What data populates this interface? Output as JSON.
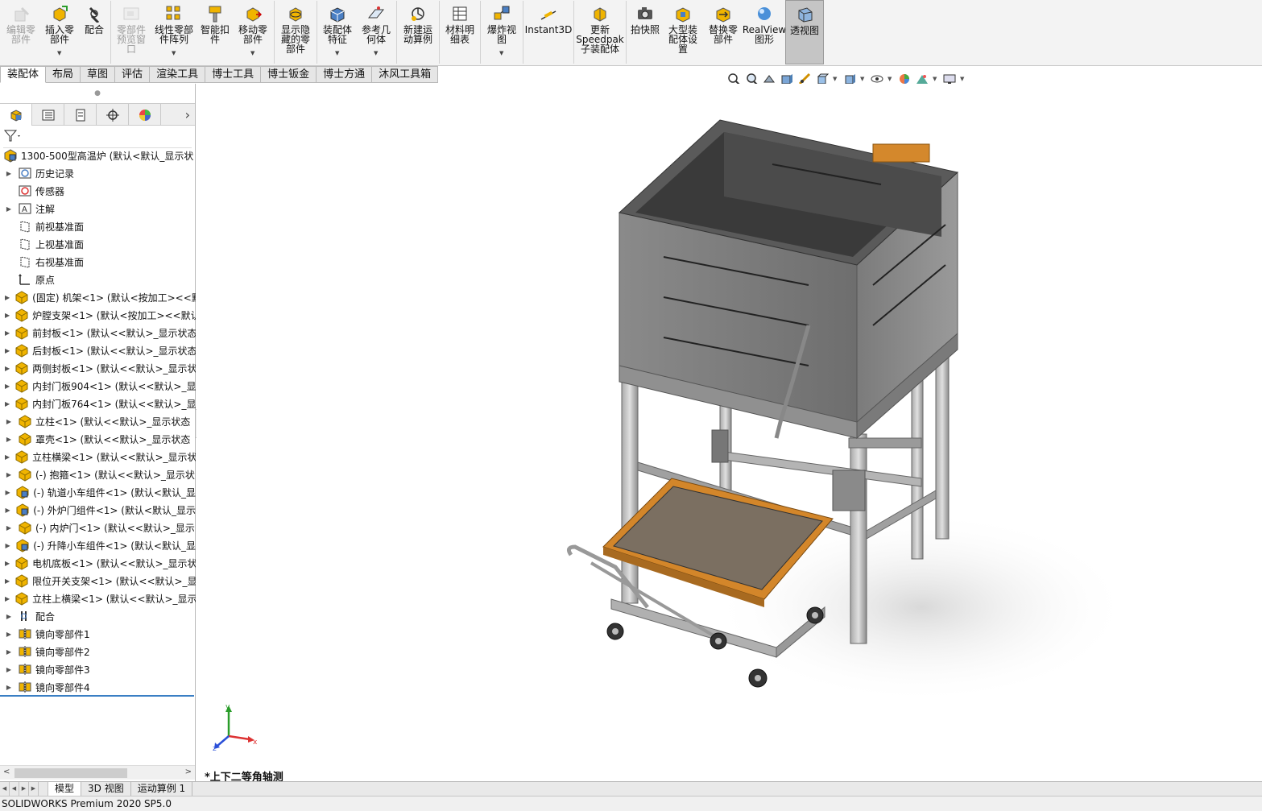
{
  "ribbon": {
    "buttons": [
      {
        "label": "编辑零\n部件",
        "icon": "edit-component-icon",
        "disabled": true
      },
      {
        "label": "插入零\n部件",
        "icon": "insert-component-icon",
        "caret": true
      },
      {
        "label": "配合",
        "icon": "mate-icon"
      },
      {
        "label": "零部件\n预览窗\n口",
        "icon": "component-preview-icon",
        "disabled": true
      },
      {
        "label": "线性零部\n件阵列",
        "icon": "linear-pattern-icon",
        "caret": true
      },
      {
        "label": "智能扣\n件",
        "icon": "smart-fasteners-icon"
      },
      {
        "label": "移动零\n部件",
        "icon": "move-component-icon",
        "caret": true
      },
      {
        "label": "显示隐\n藏的零\n部件",
        "icon": "show-hidden-icon"
      },
      {
        "label": "装配体\n特征",
        "icon": "assembly-features-icon",
        "caret": true
      },
      {
        "label": "参考几\n何体",
        "icon": "reference-geometry-icon",
        "caret": true
      },
      {
        "label": "新建运\n动算例",
        "icon": "motion-study-icon"
      },
      {
        "label": "材料明\n细表",
        "icon": "bom-icon"
      },
      {
        "label": "爆炸视\n图",
        "icon": "exploded-view-icon",
        "caret": true
      },
      {
        "label": "Instant3D",
        "icon": "instant3d-icon"
      },
      {
        "label": "更新\nSpeedpak\n子装配体",
        "icon": "speedpak-icon"
      },
      {
        "label": "拍快照",
        "icon": "snapshot-icon"
      },
      {
        "label": "大型装\n配体设\n置",
        "icon": "large-assembly-icon"
      },
      {
        "label": "替换零\n部件",
        "icon": "replace-component-icon"
      },
      {
        "label": "RealView\n图形",
        "icon": "realview-icon"
      },
      {
        "label": "透视图",
        "icon": "perspective-icon",
        "active": true
      }
    ]
  },
  "tabs": [
    "装配体",
    "布局",
    "草图",
    "评估",
    "渲染工具",
    "博士工具",
    "博士钣金",
    "博士方通",
    "沐风工具箱"
  ],
  "tree": {
    "root": "1300-500型高温炉 (默认<默认_显示状",
    "items": [
      {
        "label": "历史记录",
        "icon": "history-icon",
        "expand": true
      },
      {
        "label": "传感器",
        "icon": "sensor-icon",
        "expand": false
      },
      {
        "label": "注解",
        "icon": "annotation-icon",
        "expand": true
      },
      {
        "label": "前视基准面",
        "icon": "plane-icon",
        "expand": false
      },
      {
        "label": "上视基准面",
        "icon": "plane-icon",
        "expand": false
      },
      {
        "label": "右视基准面",
        "icon": "plane-icon",
        "expand": false
      },
      {
        "label": "原点",
        "icon": "origin-icon",
        "expand": false
      },
      {
        "label": "(固定) 机架<1> (默认<按加工><<默",
        "icon": "part-icon",
        "expand": true
      },
      {
        "label": "炉膛支架<1> (默认<按加工><<默认",
        "icon": "part-icon",
        "expand": true
      },
      {
        "label": "前封板<1> (默认<<默认>_显示状态",
        "icon": "part-icon",
        "expand": true
      },
      {
        "label": "后封板<1> (默认<<默认>_显示状态",
        "icon": "part-icon",
        "expand": true
      },
      {
        "label": "两侧封板<1> (默认<<默认>_显示状",
        "icon": "part-icon",
        "expand": true
      },
      {
        "label": "内封门板904<1> (默认<<默认>_显",
        "icon": "part-icon",
        "expand": true
      },
      {
        "label": "内封门板764<1> (默认<<默认>_显",
        "icon": "part-icon",
        "expand": true
      },
      {
        "label": "立柱<1> (默认<<默认>_显示状态",
        "icon": "part-icon",
        "expand": true
      },
      {
        "label": "罩壳<1> (默认<<默认>_显示状态",
        "icon": "part-icon",
        "expand": true
      },
      {
        "label": "立柱横梁<1> (默认<<默认>_显示状",
        "icon": "part-icon",
        "expand": true
      },
      {
        "label": "(-) 抱箍<1> (默认<<默认>_显示状",
        "icon": "part-icon",
        "expand": true
      },
      {
        "label": "(-) 轨道小车组件<1> (默认<默认_显",
        "icon": "subassembly-icon",
        "expand": true
      },
      {
        "label": "(-) 外炉门组件<1> (默认<默认_显示",
        "icon": "subassembly-icon",
        "expand": true
      },
      {
        "label": "(-) 内炉门<1> (默认<<默认>_显示",
        "icon": "part-icon",
        "expand": true
      },
      {
        "label": "(-) 升降小车组件<1> (默认<默认_显",
        "icon": "subassembly-icon",
        "expand": true
      },
      {
        "label": "电机底板<1> (默认<<默认>_显示状",
        "icon": "part-icon",
        "expand": true
      },
      {
        "label": "限位开关支架<1> (默认<<默认>_显",
        "icon": "part-icon",
        "expand": true
      },
      {
        "label": "立柱上横梁<1> (默认<<默认>_显示",
        "icon": "part-icon",
        "expand": true
      },
      {
        "label": "配合",
        "icon": "mates-folder-icon",
        "expand": true
      },
      {
        "label": "镜向零部件1",
        "icon": "mirror-component-icon",
        "expand": true
      },
      {
        "label": "镜向零部件2",
        "icon": "mirror-component-icon",
        "expand": true
      },
      {
        "label": "镜向零部件3",
        "icon": "mirror-component-icon",
        "expand": true
      },
      {
        "label": "镜向零部件4",
        "icon": "mirror-component-icon",
        "expand": true
      }
    ]
  },
  "viewport": {
    "view_name": "*上下二等角轴测",
    "triad": {
      "x": "x",
      "y": "y",
      "z": "z"
    }
  },
  "bottom_tabs": [
    "模型",
    "3D 视图",
    "运动算例 1"
  ],
  "status": "SOLIDWORKS Premium 2020 SP5.0",
  "colors": {
    "ribbon_bg": "#f3f3f3",
    "active_button": "#c5c5c5",
    "part_icon": "#f0b400",
    "accent": "#3a7fc4"
  }
}
